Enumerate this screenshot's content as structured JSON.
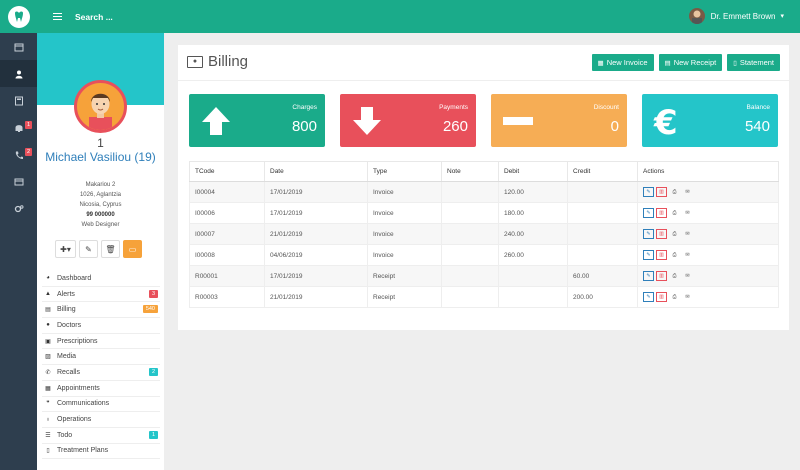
{
  "topbar": {
    "search_label": "Search ...",
    "user_name": "Dr. Emmett Brown"
  },
  "rail": {
    "items": [
      {
        "icon": "calendar-icon",
        "badge": ""
      },
      {
        "icon": "user-icon",
        "badge": "",
        "active": true
      },
      {
        "icon": "calculator-icon",
        "badge": ""
      },
      {
        "icon": "bell-icon",
        "badge": "1"
      },
      {
        "icon": "phone-icon",
        "badge": "2"
      },
      {
        "icon": "card-icon",
        "badge": ""
      },
      {
        "icon": "cogs-icon",
        "badge": ""
      }
    ]
  },
  "patient": {
    "number": "1",
    "name": "Michael Vasiliou (19)",
    "address1": "Makariou 2",
    "address2": "1026, Aglantzia",
    "address3": "Nicosia, Cyprus",
    "phone": "99 000000",
    "occupation": "Web Designer"
  },
  "menu": [
    {
      "icon": "dashboard-icon",
      "label": "Dashboard",
      "badge": ""
    },
    {
      "icon": "bell-icon",
      "label": "Alerts",
      "badge": "3",
      "badge_color": "#e8505b"
    },
    {
      "icon": "money-icon",
      "label": "Billing",
      "badge": "540",
      "badge_color": "#f6a23a"
    },
    {
      "icon": "doctor-icon",
      "label": "Doctors",
      "badge": ""
    },
    {
      "icon": "medkit-icon",
      "label": "Prescriptions",
      "badge": ""
    },
    {
      "icon": "image-icon",
      "label": "Media",
      "badge": ""
    },
    {
      "icon": "phone-icon",
      "label": "Recalls",
      "badge": "2",
      "badge_color": "#24c5c9"
    },
    {
      "icon": "calendar-icon",
      "label": "Appointments",
      "badge": ""
    },
    {
      "icon": "comments-icon",
      "label": "Communications",
      "badge": ""
    },
    {
      "icon": "stethoscope-icon",
      "label": "Operations",
      "badge": ""
    },
    {
      "icon": "list-icon",
      "label": "Todo",
      "badge": "1",
      "badge_color": "#24c5c9"
    },
    {
      "icon": "file-icon",
      "label": "Treatment Plans",
      "badge": ""
    }
  ],
  "billing": {
    "title": "Billing",
    "buttons": {
      "new_invoice": "New Invoice",
      "new_receipt": "New Receipt",
      "statement": "Statement"
    },
    "stats": [
      {
        "label": "Charges",
        "value": "800",
        "color": "#1aab8a",
        "icon": "arrow-up-icon"
      },
      {
        "label": "Payments",
        "value": "260",
        "color": "#e8505b",
        "icon": "arrow-down-icon"
      },
      {
        "label": "Discount",
        "value": "0",
        "color": "#f6ad55",
        "icon": "minus-icon"
      },
      {
        "label": "Balance",
        "value": "540",
        "color": "#24c5c9",
        "icon": "euro-icon"
      }
    ],
    "columns": [
      "TCode",
      "Date",
      "Type",
      "Note",
      "Debit",
      "Credit",
      "Actions"
    ],
    "rows": [
      {
        "tcode": "I00004",
        "date": "17/01/2019",
        "type": "Invoice",
        "note": "",
        "debit": "120.00",
        "credit": ""
      },
      {
        "tcode": "I00006",
        "date": "17/01/2019",
        "type": "Invoice",
        "note": "",
        "debit": "180.00",
        "credit": ""
      },
      {
        "tcode": "I00007",
        "date": "21/01/2019",
        "type": "Invoice",
        "note": "",
        "debit": "240.00",
        "credit": ""
      },
      {
        "tcode": "I00008",
        "date": "04/06/2019",
        "type": "Invoice",
        "note": "",
        "debit": "260.00",
        "credit": ""
      },
      {
        "tcode": "R00001",
        "date": "17/01/2019",
        "type": "Receipt",
        "note": "",
        "debit": "",
        "credit": "60.00"
      },
      {
        "tcode": "R00003",
        "date": "21/01/2019",
        "type": "Receipt",
        "note": "",
        "debit": "",
        "credit": "200.00"
      }
    ]
  }
}
